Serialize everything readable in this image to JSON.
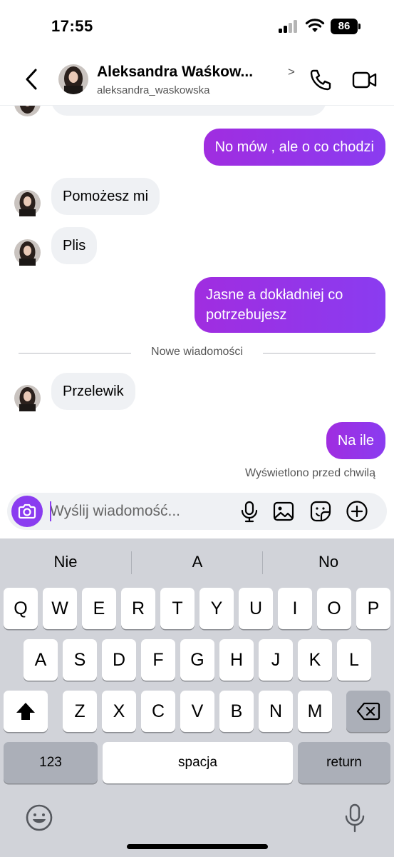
{
  "status_bar": {
    "time": "17:55",
    "battery": "86"
  },
  "header": {
    "contact_name": "Aleksandra Waśkow...",
    "chevron": ">",
    "username": "aleksandra_waskowska",
    "icons": [
      "back-icon",
      "phone-icon",
      "video-camera-icon"
    ]
  },
  "messages": [
    {
      "from": "me",
      "text": "No mów , ale o co chodzi"
    },
    {
      "from": "contact",
      "text": "Pomożesz mi"
    },
    {
      "from": "contact",
      "text": "Plis"
    },
    {
      "from": "me",
      "text": "Jasne a dokładniej co potrzebujesz"
    },
    {
      "from": "contact",
      "text": "Przelewik"
    },
    {
      "from": "me",
      "text": "Na ile"
    }
  ],
  "separator_label": "Nowe wiadomości",
  "seen_status": "Wyświetlono przed chwilą",
  "composer": {
    "placeholder": "Wyślij wiadomość...",
    "icons": [
      "camera-icon",
      "microphone-icon",
      "gallery-icon",
      "sticker-icon",
      "plus-icon"
    ]
  },
  "keyboard": {
    "suggestions": [
      "Nie",
      "A",
      "No"
    ],
    "row1": [
      "Q",
      "W",
      "E",
      "R",
      "T",
      "Y",
      "U",
      "I",
      "O",
      "P"
    ],
    "row2": [
      "A",
      "S",
      "D",
      "F",
      "G",
      "H",
      "J",
      "K",
      "L"
    ],
    "row3": [
      "Z",
      "X",
      "C",
      "V",
      "B",
      "N",
      "M"
    ],
    "numbers_key": "123",
    "space_key": "spacja",
    "return_key": "return",
    "icons": [
      "shift-icon",
      "delete-icon",
      "emoji-icon",
      "dictation-icon"
    ]
  },
  "colors": {
    "outgoing_start": "#a02de0",
    "outgoing_end": "#8a3cf0",
    "incoming_bubble": "#eff1f4",
    "accent": "#8a3cf0",
    "keyboard_bg": "#d1d3d9"
  }
}
